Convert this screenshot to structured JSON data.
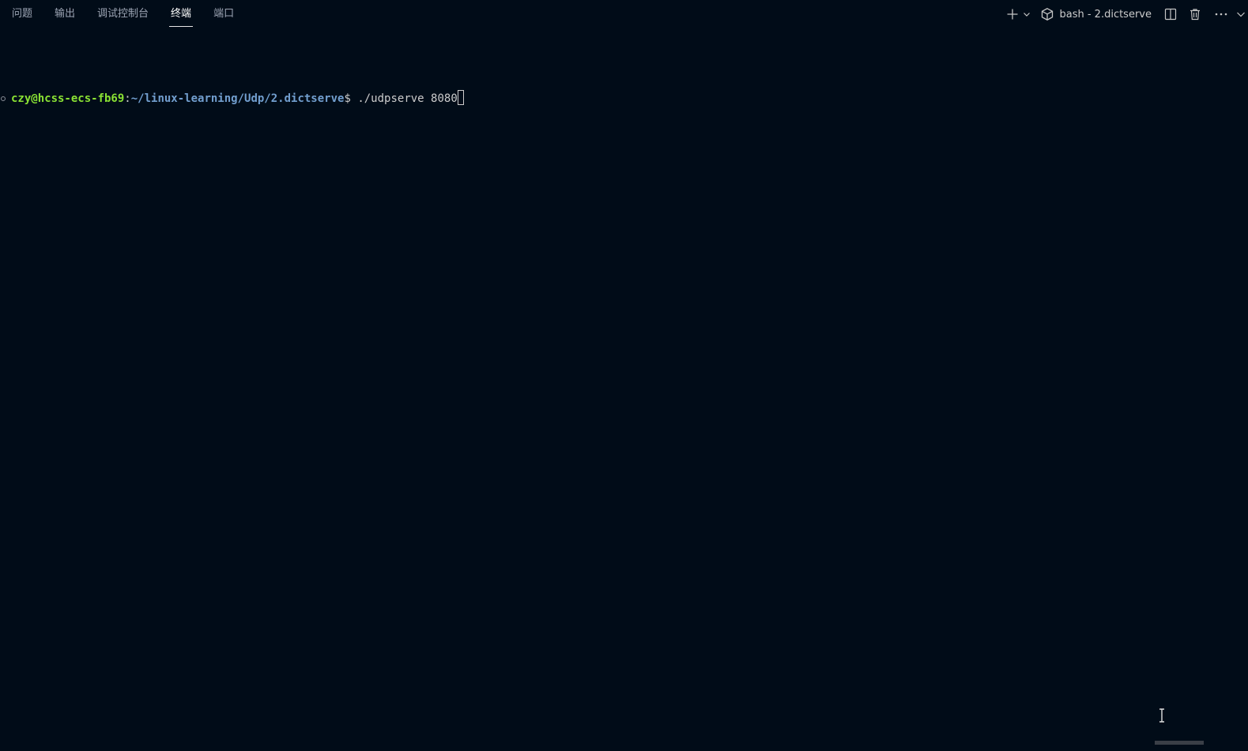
{
  "tabs": [
    {
      "label": "问题",
      "active": false
    },
    {
      "label": "输出",
      "active": false
    },
    {
      "label": "调试控制台",
      "active": false
    },
    {
      "label": "终端",
      "active": true
    },
    {
      "label": "端口",
      "active": false
    }
  ],
  "toolbar": {
    "new_terminal_icon": "plus-icon",
    "dropdown_icon": "chevron-down-icon",
    "terminal_icon": "cube-icon",
    "terminal_name": "bash - 2.dictserve",
    "split_icon": "split-panel-icon",
    "kill_icon": "trash-icon",
    "more_icon": "ellipsis-icon",
    "collapse_icon": "chevron-down-icon"
  },
  "terminal": {
    "user_host": "czy@hcss-ecs-fb69",
    "separator": ":",
    "path": "~/linux-learning/Udp/2.dictserve",
    "prompt_symbol": "$ ",
    "command": "./udpserve 8080"
  },
  "colors": {
    "background": "#010c18",
    "user_host": "#8ae234",
    "path": "#729fcf",
    "text": "#cccccc"
  }
}
